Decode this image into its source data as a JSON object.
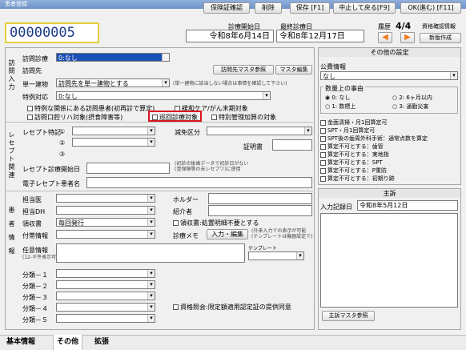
{
  "window": {
    "title": "患者登録"
  },
  "header": {
    "patient_id": "00000005",
    "first_visit_label": "診療開始日",
    "first_visit_value": "令和8年6月14日",
    "last_visit_label": "最終診療日",
    "last_visit_value": "令和8年12月17日",
    "history_label": "履歴",
    "history_value": "4/4",
    "qualification_check": "資格確認情報",
    "new_version": "新版作成"
  },
  "left": {
    "section_label": "訪問入力",
    "visit_clinic_label": "訪問診療",
    "visit_clinic_value": "0:なし",
    "visit_dest_label": "訪問先",
    "visit_dest_master_btn": "訪問先マスタ参照",
    "master_edit_btn": "マスタ編集",
    "single_building_label": "単一建物",
    "single_building_value": "訪問先を単一建物とする",
    "single_building_hint": "(単一建物に該当しない場合は事情を確認して下さい)",
    "special_label": "特例対応",
    "special_value": "0:なし",
    "special_rel_label": "特例な関係にある訪問患者(初再診で算定)",
    "palliative_label": "緩和ケア/がん末期対象",
    "difficult_label": "訪問口腔リハ対象(摂食障害等)",
    "patrol_label": "巡回診療対象",
    "special_mgmt_label": "特別管理加算の対象",
    "receipt_section_label": "レセプト関連",
    "receipt_special_label": "レセプト特記",
    "receipt_special_nums": [
      "①",
      "②",
      "③"
    ],
    "reduction_label": "減免区分",
    "certificate_label": "証明書",
    "receipt_start_label": "レセプト診療開始日",
    "receipt_start_hint": "(初診の後歯データで初診日がない\n(翌保険等の未レセブツ)に使用",
    "e_receipt_name_label": "電子レセプト患者名",
    "patient_section_label": "患者情報",
    "doctor_label": "担当医",
    "dh_label": "担当DH",
    "receipt_issue_label": "領収書",
    "receipt_issue_value": "毎回発行",
    "attached_info_label": "付帯情報",
    "holder_label": "ホルダー",
    "introducer_label": "紹介者",
    "treatment_detail_label": "領収書:処置明細不要とする",
    "clinical_memo_label": "診療メモ",
    "input_edit_btn": "入力・編集",
    "memo_hint": "(外来入力での表示が可能\n(テンプレートは機器設定で)",
    "template_label": "テンプレート",
    "free_info_label": "任意情報",
    "free_info_hint": "(12-ギ件表示可)",
    "classifications": [
      "分類－１",
      "分類－２",
      "分類－３",
      "分類－４",
      "分類－５"
    ],
    "qualification_consent_label": "資格照会:限定額適用認定証の提供同意"
  },
  "right": {
    "other_settings_title": "その他の設定",
    "public_info_label": "公費情報",
    "public_info_value": "なし",
    "quantity_title": "数量上の事由",
    "radios": [
      {
        "label": "0: なし",
        "checked": true
      },
      {
        "label": "2: 6ヶ月以内",
        "checked": false
      },
      {
        "label": "1: 数標上",
        "checked": false
      },
      {
        "label": "3: 通勤災害",
        "checked": false
      }
    ],
    "checks": [
      "金面清掃・月1回算定可",
      "SPT・月1回算定可",
      "SPT後の歯周外科手術：通常点数を算定",
      "算定不可とする：歯管",
      "算定不可とする：実地指",
      "算定不可とする：SPT",
      "算定不可とする：P重防",
      "算定不可とする：初期り跡"
    ],
    "chief_title": "主訴",
    "entry_date_label": "入力記録日",
    "entry_date_value": "令和8年5月12日",
    "chief_master_btn": "主訴マスタ参照"
  },
  "footer": {
    "tabs": [
      "基本情報",
      "その他",
      "拡張"
    ],
    "insurance_check": "保険証確認",
    "delete": "削除",
    "save": "保存 [F1]",
    "cancel_back": "中止して戻る[F9]",
    "ok_next": "OK(進む) [F11]"
  },
  "colors": {
    "accent_yellow": "#e3cf3a",
    "highlight_red": "#d8161f",
    "nav_orange": "#f07b1c"
  }
}
